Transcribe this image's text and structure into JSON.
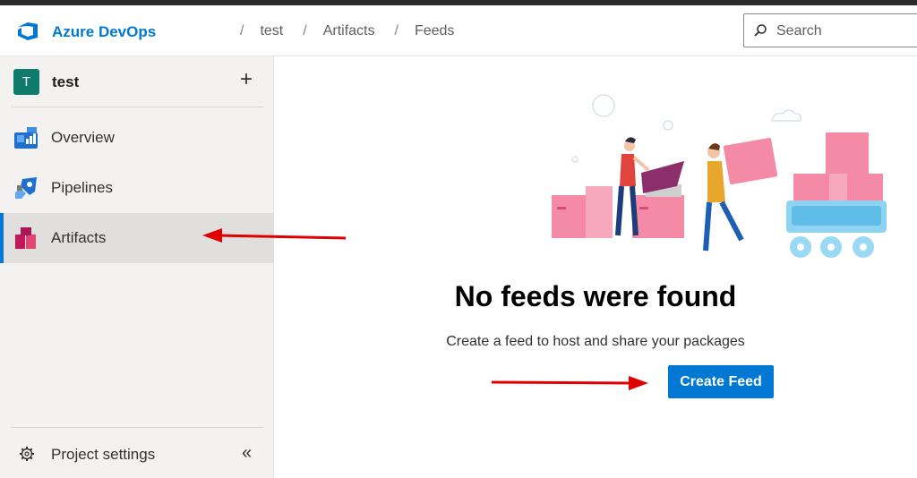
{
  "app": {
    "brand": "Azure DevOps"
  },
  "breadcrumb": {
    "items": [
      "test",
      "Artifacts",
      "Feeds"
    ]
  },
  "search": {
    "placeholder": "Search"
  },
  "sidebar": {
    "project": {
      "avatar_letter": "T",
      "name": "test"
    },
    "items": [
      {
        "label": "Overview",
        "icon": "overview-icon"
      },
      {
        "label": "Pipelines",
        "icon": "pipelines-icon"
      },
      {
        "label": "Artifacts",
        "icon": "artifacts-icon",
        "selected": true
      }
    ],
    "settings_label": "Project settings"
  },
  "main": {
    "empty_title": "No feeds were found",
    "empty_subtitle": "Create a feed to host and share your packages",
    "create_button": "Create Feed"
  },
  "colors": {
    "accent": "#0078d4",
    "annotation_arrow": "#e00000",
    "project_avatar": "#0f7b6c"
  }
}
